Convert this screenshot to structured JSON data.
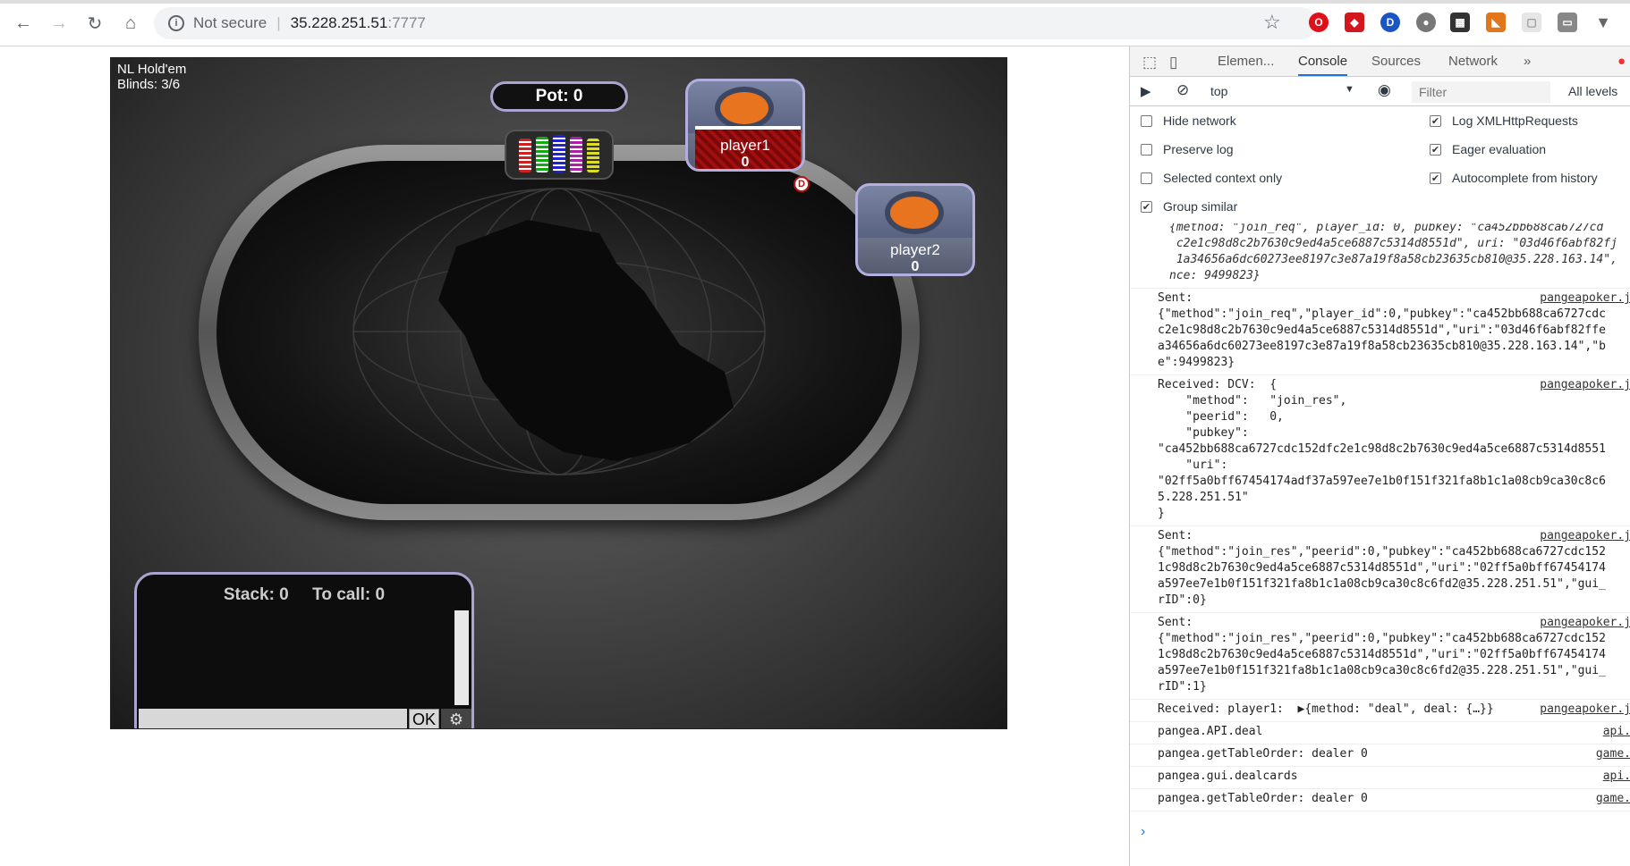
{
  "browser": {
    "security_label": "Not secure",
    "url_host": "35.228.251.51",
    "url_port": ":7777"
  },
  "game": {
    "variant": "NL Hold'em",
    "blinds": "Blinds: 3/6",
    "pot": "Pot: 0",
    "players": [
      {
        "name": "player1",
        "stack": "0"
      },
      {
        "name": "player2",
        "stack": "0"
      }
    ],
    "dealer_badge": "D",
    "panel": {
      "stack": "Stack: 0",
      "to_call": "To call: 0",
      "ok_label": "OK"
    }
  },
  "devtools": {
    "tabs": [
      "Elemen...",
      "Console",
      "Sources",
      "Network",
      "»"
    ],
    "context": "top",
    "filter_placeholder": "Filter",
    "levels": "All levels",
    "options": {
      "hide_network": "Hide network",
      "preserve_log": "Preserve log",
      "selected_context_only": "Selected context only",
      "group_similar": "Group similar",
      "log_xhr": "Log XMLHttpRequests",
      "eager_evaluation": "Eager evaluation",
      "autocomplete": "Autocomplete from history"
    },
    "messages": [
      {
        "text": "{method: \"join_req\", player_id: 0, pubkey: \"ca452bb688ca6727cd\n c2e1c98d8c2b7630c9ed4a5ce6887c5314d8551d\", uri: \"03d46f6abf82fj\n 1a34656a6dc60273ee8197c3e87a19f8a58cb23635cb810@35.228.163.14\",\nnce: 9499823}",
        "src": ""
      },
      {
        "text": "Sent:\n{\"method\":\"join_req\",\"player_id\":0,\"pubkey\":\"ca452bb688ca6727cdc\nc2e1c98d8c2b7630c9ed4a5ce6887c5314d8551d\",\"uri\":\"03d46f6abf82ffe\na34656a6dc60273ee8197c3e87a19f8a58cb23635cb810@35.228.163.14\",\"b\ne\":9499823}",
        "src": "pangeapoker.j"
      },
      {
        "text": "Received: DCV:  {\n    \"method\":   \"join_res\",\n    \"peerid\":   0,\n    \"pubkey\":\n\"ca452bb688ca6727cdc152dfc2e1c98d8c2b7630c9ed4a5ce6887c5314d8551\n    \"uri\":\n\"02ff5a0bff67454174adf37a597ee7e1b0f151f321fa8b1c1a08cb9ca30c8c6\n5.228.251.51\"\n}",
        "src": "pangeapoker.j"
      },
      {
        "text": "Sent:\n{\"method\":\"join_res\",\"peerid\":0,\"pubkey\":\"ca452bb688ca6727cdc152\n1c98d8c2b7630c9ed4a5ce6887c5314d8551d\",\"uri\":\"02ff5a0bff67454174\na597ee7e1b0f151f321fa8b1c1a08cb9ca30c8c6fd2@35.228.251.51\",\"gui_\nrID\":0}",
        "src": "pangeapoker.j"
      },
      {
        "text": "Sent:\n{\"method\":\"join_res\",\"peerid\":0,\"pubkey\":\"ca452bb688ca6727cdc152\n1c98d8c2b7630c9ed4a5ce6887c5314d8551d\",\"uri\":\"02ff5a0bff67454174\na597ee7e1b0f151f321fa8b1c1a08cb9ca30c8c6fd2@35.228.251.51\",\"gui_\nrID\":1}",
        "src": "pangeapoker.j"
      },
      {
        "text": "Received: player1:  ▶{method: \"deal\", deal: {…}}",
        "src": "pangeapoker.j"
      },
      {
        "text": "pangea.API.deal",
        "src": "api."
      },
      {
        "text": "pangea.getTableOrder: dealer 0",
        "src": "game."
      },
      {
        "text": "pangea.gui.dealcards",
        "src": "api."
      },
      {
        "text": "pangea.getTableOrder: dealer 0",
        "src": "game."
      }
    ],
    "prompt": "›"
  }
}
